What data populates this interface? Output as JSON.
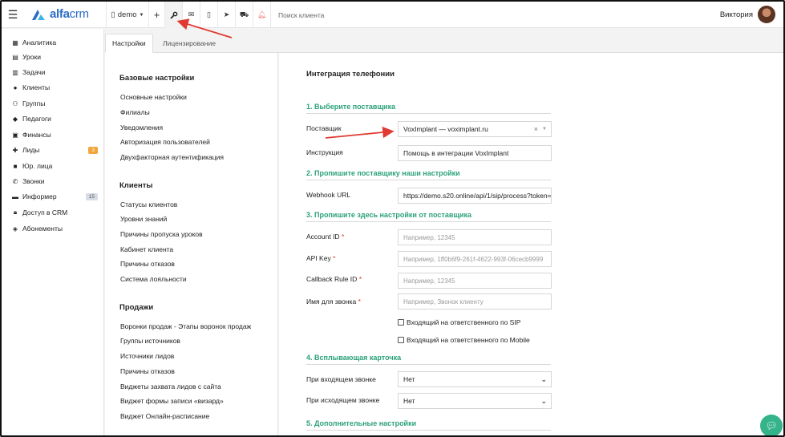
{
  "topbar": {
    "logo_main": "alfa",
    "logo_accent": "crm",
    "branch": "demo",
    "search_placeholder": "Поиск клиента",
    "user_name": "Виктория"
  },
  "sidebar": {
    "items": [
      {
        "label": "Аналитика",
        "icon": "chart-icon"
      },
      {
        "label": "Уроки",
        "icon": "calendar-icon"
      },
      {
        "label": "Задачи",
        "icon": "tasks-icon"
      },
      {
        "label": "Клиенты",
        "icon": "user-icon"
      },
      {
        "label": "Группы",
        "icon": "users-icon"
      },
      {
        "label": "Педагоги",
        "icon": "graduation-cap-icon"
      },
      {
        "label": "Финансы",
        "icon": "money-icon"
      },
      {
        "label": "Лиды",
        "icon": "user-plus-icon",
        "badge": "3"
      },
      {
        "label": "Юр. лица",
        "icon": "briefcase-icon"
      },
      {
        "label": "Звонки",
        "icon": "phone-icon"
      },
      {
        "label": "Информер",
        "icon": "informer-icon",
        "badge": "15"
      },
      {
        "label": "Доступ в CRM",
        "icon": "lock-icon"
      },
      {
        "label": "Абонементы",
        "icon": "tag-icon"
      }
    ]
  },
  "tabs": [
    "Настройки",
    "Лицензирование"
  ],
  "settings_nav": {
    "base_title": "Базовые настройки",
    "base_items": [
      "Основные настройки",
      "Филиалы",
      "Уведомления",
      "Авторизация пользователей",
      "Двухфакторная аутентификация"
    ],
    "clients_title": "Клиенты",
    "clients_items": [
      "Статусы клиентов",
      "Уровни знаний",
      "Причины пропуска уроков",
      "Кабинет клиента",
      "Причины отказов",
      "Система лояльности"
    ],
    "sales_title": "Продажи",
    "sales_items": [
      "Воронки продаж - Этапы воронок продаж",
      "Группы источников",
      "Источники лидов",
      "Причины отказов",
      "Виджеты захвата лидов с сайта",
      "Виджет формы записи «визард»",
      "Виджет Онлайн-расписание"
    ]
  },
  "main": {
    "title": "Интеграция телефонии",
    "sec1": "1. Выберите поставщика",
    "provider_label": "Поставщик",
    "provider_value": "VoxImplant — voximplant.ru",
    "instruction_label": "Инструкция",
    "instruction_value": "Помощь в интеграции VoxImplant",
    "sec2": "2. Пропишите поставщику наши настройки",
    "webhook_label": "Webhook URL",
    "webhook_value": "https://demo.s20.online/api/1/sip/process?token=",
    "sec3": "3. Пропишите здесь настройки от поставщика",
    "account_label": "Account ID",
    "account_ph": "Например, 12345",
    "apikey_label": "API Key",
    "apikey_ph": "Например, 1ff0b6f9-261f-4622-993f-06cecb9999",
    "callback_label": "Callback Rule ID",
    "callback_ph": "Например, 12345",
    "callname_label": "Имя для звонка",
    "callname_ph": "Например, Звонок клиенту",
    "chk_sip": "Входящий на ответственного по SIP",
    "chk_mobile": "Входящий на ответственного по Mobile",
    "sec4": "4. Всплывающая карточка",
    "incoming_label": "При входящем звонке",
    "incoming_value": "Нет",
    "outgoing_label": "При исходящем звонке",
    "outgoing_value": "Нет",
    "sec5": "5. Дополнительные настройки",
    "required_mark": "*"
  },
  "colors": {
    "accent_green": "#2aa17a",
    "logo_blue": "#2b6cc4",
    "arrow_red": "#e03a32",
    "badge_orange": "#f0a63a",
    "chat_green": "#35b38a"
  }
}
